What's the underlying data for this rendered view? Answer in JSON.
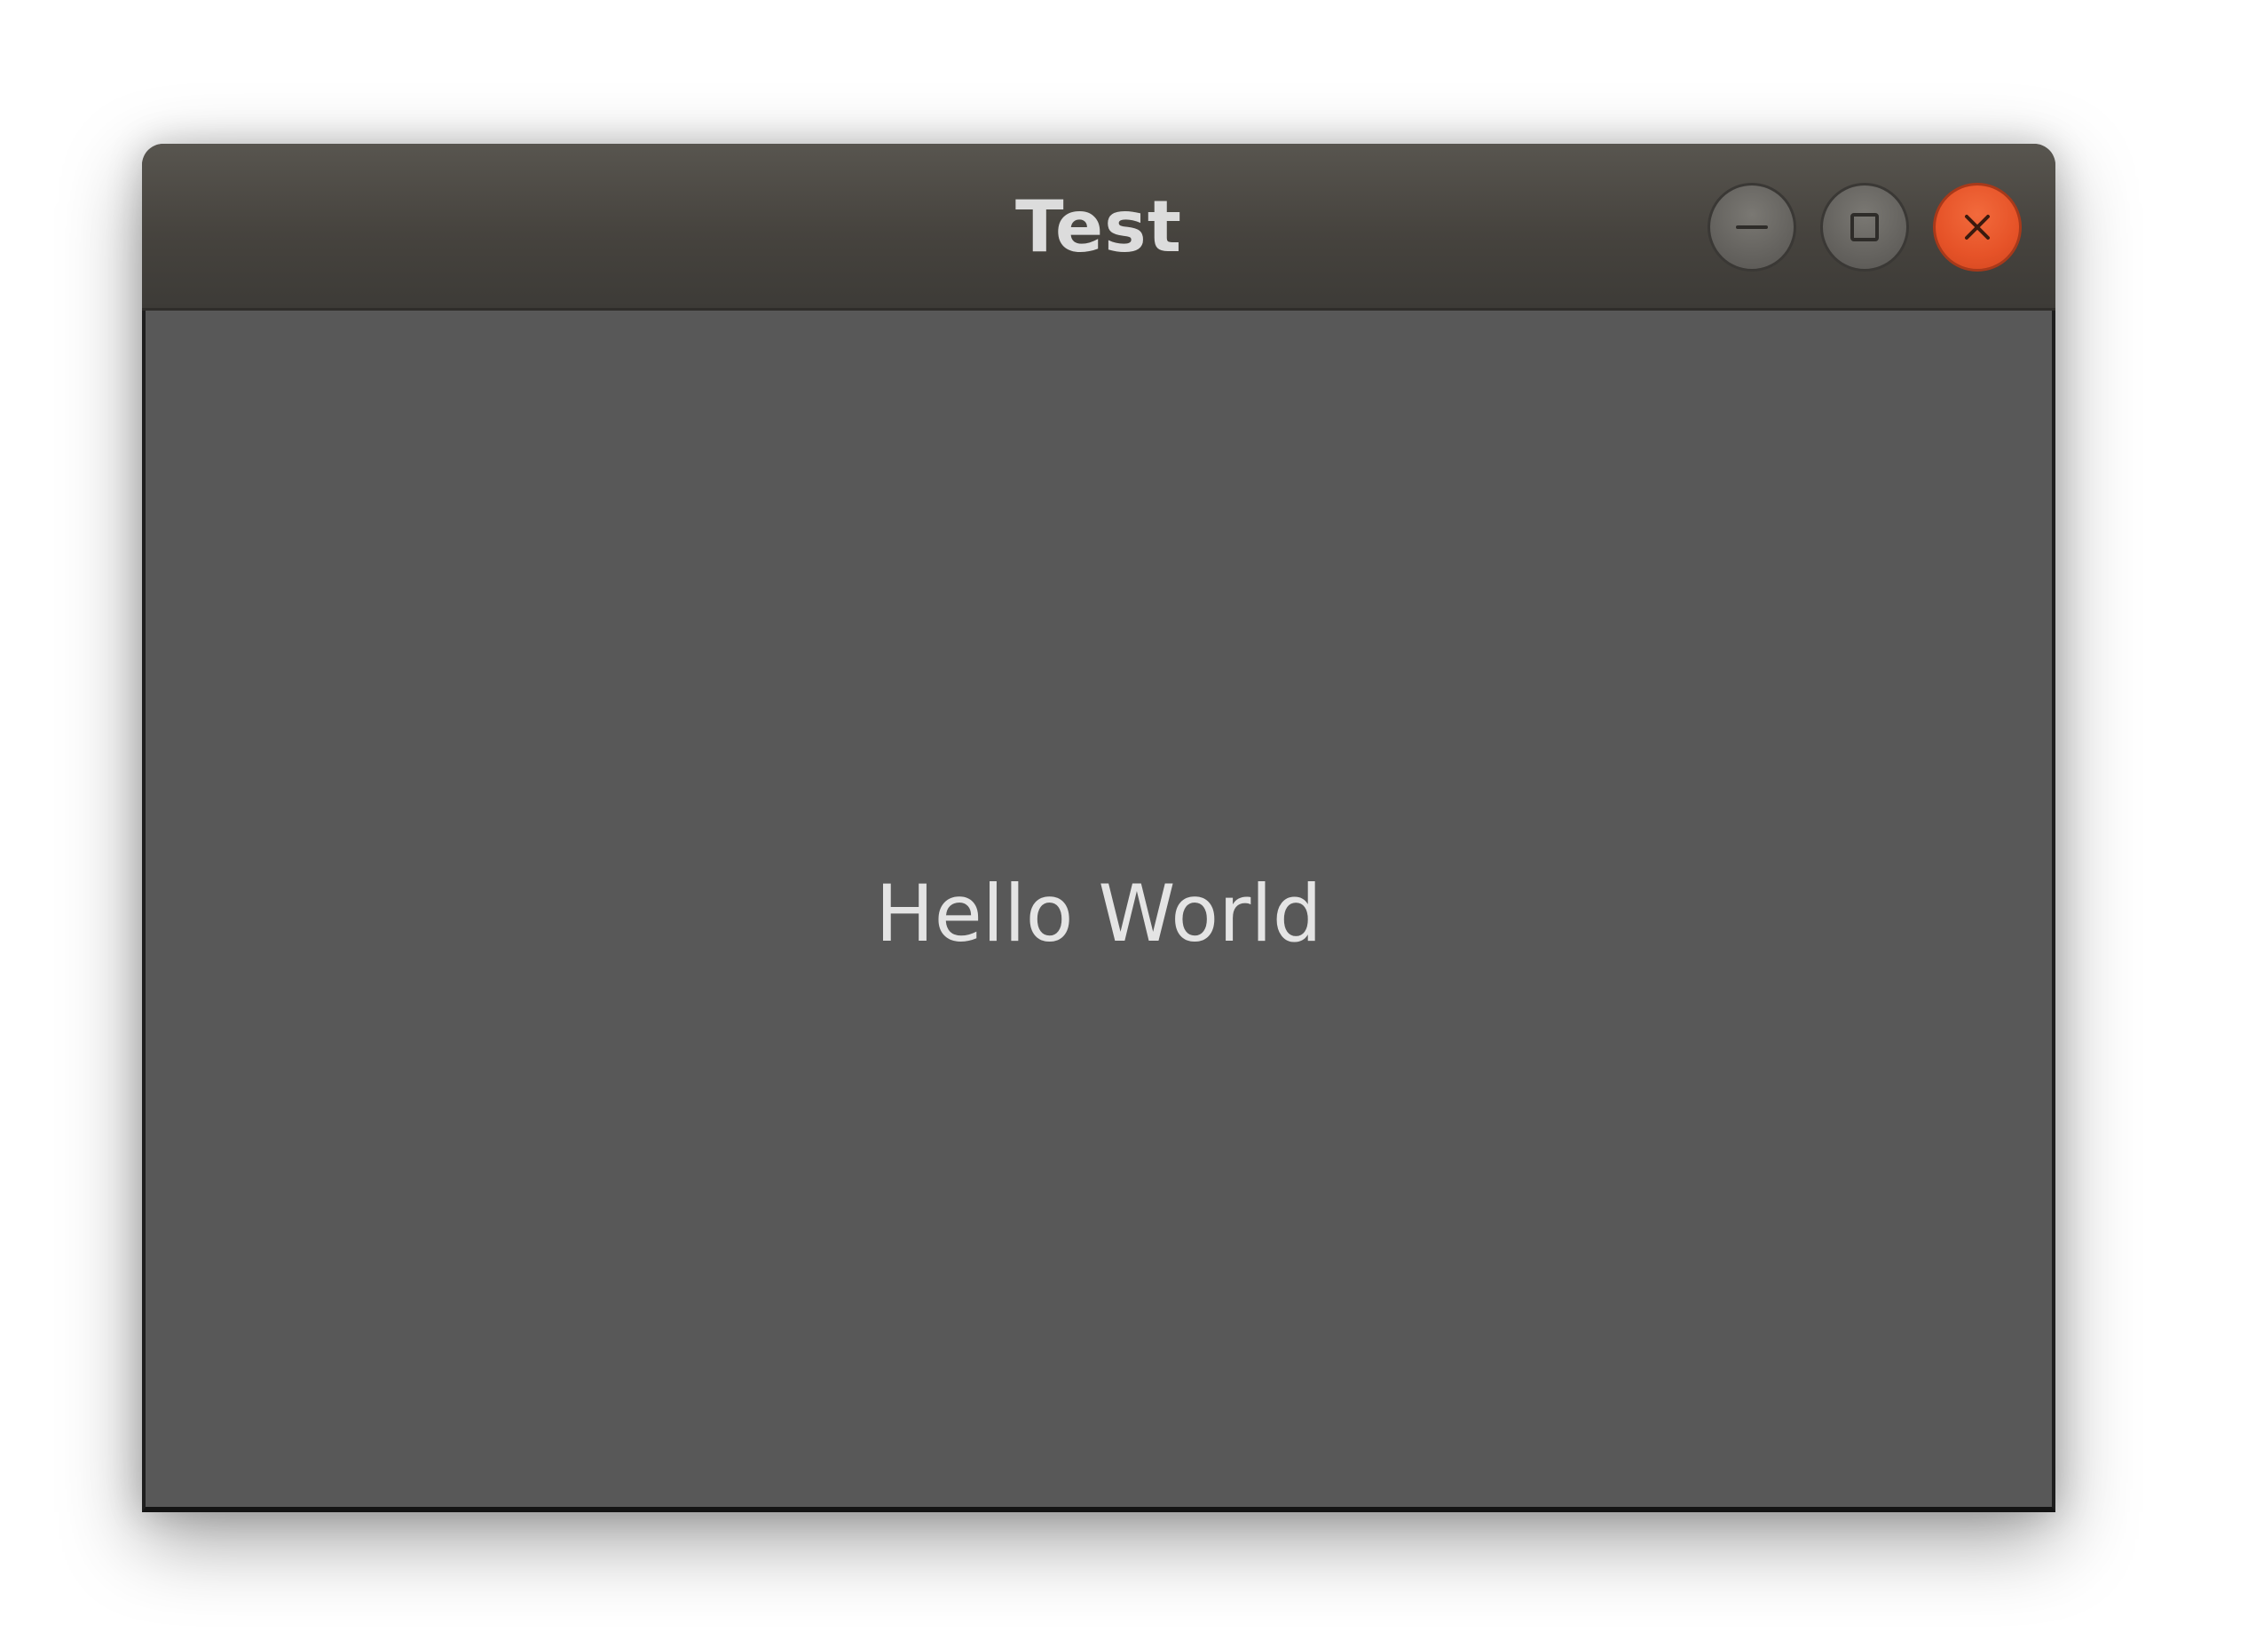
{
  "window": {
    "title": "Test",
    "controls": {
      "minimize_icon": "minimize-icon",
      "maximize_icon": "maximize-icon",
      "close_icon": "close-icon"
    }
  },
  "content": {
    "label": "Hello World"
  },
  "colors": {
    "titlebar": "#46433e",
    "content_bg": "#585858",
    "close_button": "#e65328",
    "text": "#e4e4e4"
  }
}
